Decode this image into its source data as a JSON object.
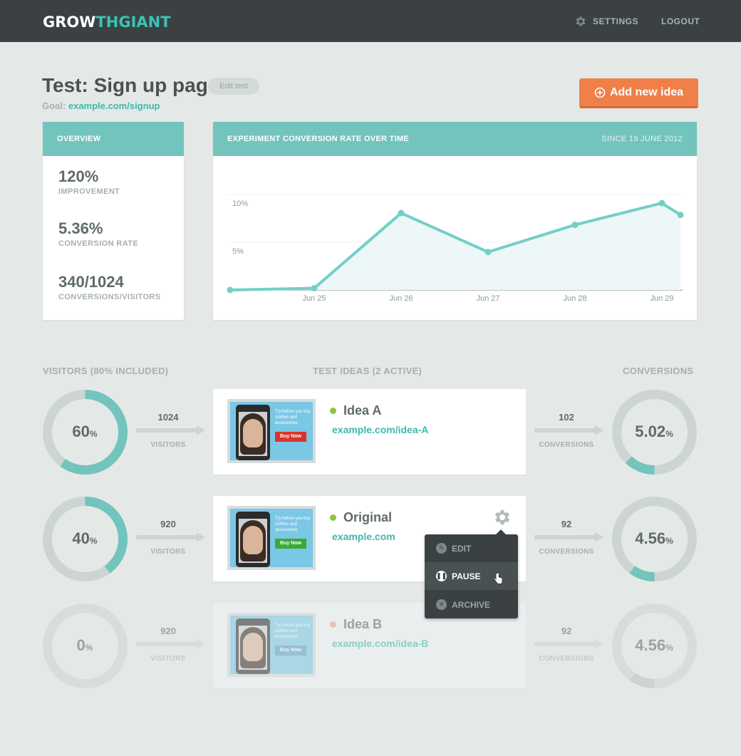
{
  "header": {
    "logo_part1": "GROW",
    "logo_part2": "THGIANT",
    "settings_label": "SETTINGS",
    "logout_label": "LOGOUT"
  },
  "page": {
    "title": "Test: Sign up page",
    "edit_label": "Edit test",
    "goal_label": "Goal:",
    "goal_url": "example.com/signup",
    "add_idea_label": "Add new idea"
  },
  "overview": {
    "title": "OVERVIEW",
    "stats": [
      {
        "value": "120%",
        "label": "IMPROVEMENT"
      },
      {
        "value": "5.36%",
        "label": "CONVERSION RATE"
      },
      {
        "value": "340/1024",
        "label": "CONVERSIONS/VISITORS"
      }
    ]
  },
  "chart_card": {
    "title": "EXPERIMENT CONVERSION RATE OVER TIME",
    "since": "SINCE 19 JUNE 2012"
  },
  "chart_data": {
    "type": "area",
    "x": [
      "",
      "Jun 25",
      "Jun 26",
      "Jun 27",
      "Jun 28",
      "Jun 29",
      ""
    ],
    "series": [
      {
        "values": [
          0,
          0.2,
          8.5,
          4.2,
          7.2,
          9.6,
          8.3
        ]
      }
    ],
    "y_ticks": [
      "5%",
      "10%"
    ],
    "ylim": [
      0,
      10
    ],
    "grid": true,
    "color": "#73cfc8",
    "fill": "#eef7f7"
  },
  "sections": {
    "visitors": "VISITORS (80% INCLUDED)",
    "ideas": "TEST IDEAS (2 ACTIVE)",
    "conversions": "CONVERSIONS"
  },
  "rows": [
    {
      "visitor_pct": "60",
      "visitor_fraction": 0.6,
      "visitors_num": "1024",
      "visitors_lbl": "VISITORS",
      "name": "Idea A",
      "url": "example.com/idea-A",
      "dot": "#8dc63f",
      "thumb_text": "Try before you buy clothes and accessories",
      "buy_label": "Buy Now",
      "buy_color": "#d9342b",
      "conv_num": "102",
      "conv_lbl": "CONVERSIONS",
      "conv_pct": "5.02",
      "conv_fraction": 0.12
    },
    {
      "visitor_pct": "40",
      "visitor_fraction": 0.4,
      "visitors_num": "920",
      "visitors_lbl": "VISITORS",
      "name": "Original",
      "url": "example.com",
      "dot": "#8dc63f",
      "thumb_text": "Try before you buy clothes and accessories",
      "buy_label": "Buy Now",
      "buy_color": "#3aa935",
      "conv_num": "92",
      "conv_lbl": "CONVERSIONS",
      "conv_pct": "4.56",
      "conv_fraction": 0.1
    },
    {
      "visitor_pct": "0",
      "visitor_fraction": 0,
      "visitors_num": "920",
      "visitors_lbl": "VISITORS",
      "name": "Idea B",
      "url": "example.com/idea-B",
      "dot": "#f0a58a",
      "thumb_text": "Try before you buy clothes and accessories",
      "buy_label": "Buy Now",
      "buy_color": "#5a9fc0",
      "conv_num": "92",
      "conv_lbl": "CONVERSIONS",
      "conv_pct": "4.56",
      "conv_fraction": 0.1
    }
  ],
  "percent_sign": "%",
  "dropdown": {
    "items": [
      {
        "label": "EDIT",
        "icon": "pencil-icon"
      },
      {
        "label": "PAUSE",
        "icon": "pause-icon"
      },
      {
        "label": "ARCHIVE",
        "icon": "close-icon"
      }
    ]
  }
}
